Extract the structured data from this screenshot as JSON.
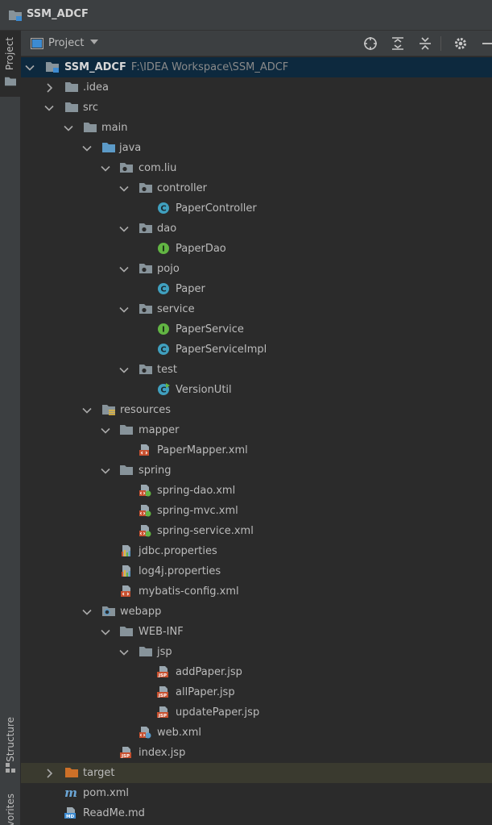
{
  "title": "SSM_ADCF",
  "left_tabs": {
    "project": "Project",
    "structure": "Structure",
    "favorites": "Favorites"
  },
  "toolbar": {
    "view_label": "Project"
  },
  "tree": {
    "root": {
      "name": "SSM_ADCF",
      "path": "F:\\IDEA Workspace\\SSM_ADCF"
    },
    "idea": ".idea",
    "src": "src",
    "main": "main",
    "java": "java",
    "com_liu": "com.liu",
    "controller": "controller",
    "paper_controller": "PaperController",
    "dao": "dao",
    "paper_dao": "PaperDao",
    "pojo": "pojo",
    "paper": "Paper",
    "service": "service",
    "paper_service": "PaperService",
    "paper_service_impl": "PaperServiceImpl",
    "test": "test",
    "version_util": "VersionUtil",
    "resources": "resources",
    "mapper": "mapper",
    "paper_mapper_xml": "PaperMapper.xml",
    "spring": "spring",
    "spring_dao_xml": "spring-dao.xml",
    "spring_mvc_xml": "spring-mvc.xml",
    "spring_service_xml": "spring-service.xml",
    "jdbc_properties": "jdbc.properties",
    "log4j_properties": "log4j.properties",
    "mybatis_config_xml": "mybatis-config.xml",
    "webapp": "webapp",
    "web_inf": "WEB-INF",
    "jsp": "jsp",
    "add_paper_jsp": "addPaper.jsp",
    "all_paper_jsp": "allPaper.jsp",
    "update_paper_jsp": "updatePaper.jsp",
    "web_xml": "web.xml",
    "index_jsp": "index.jsp",
    "target": "target",
    "pom_xml": "pom.xml",
    "readme_md": "ReadMe.md"
  },
  "colors": {
    "background": "#2b2b2b",
    "toolbar": "#3c3f41",
    "selection": "#0d293e",
    "folder": "#87939a",
    "source_folder": "#5c9ac7",
    "excluded_folder": "#cd7028",
    "class_icon": "#40a0bf",
    "interface_icon": "#62b543"
  }
}
